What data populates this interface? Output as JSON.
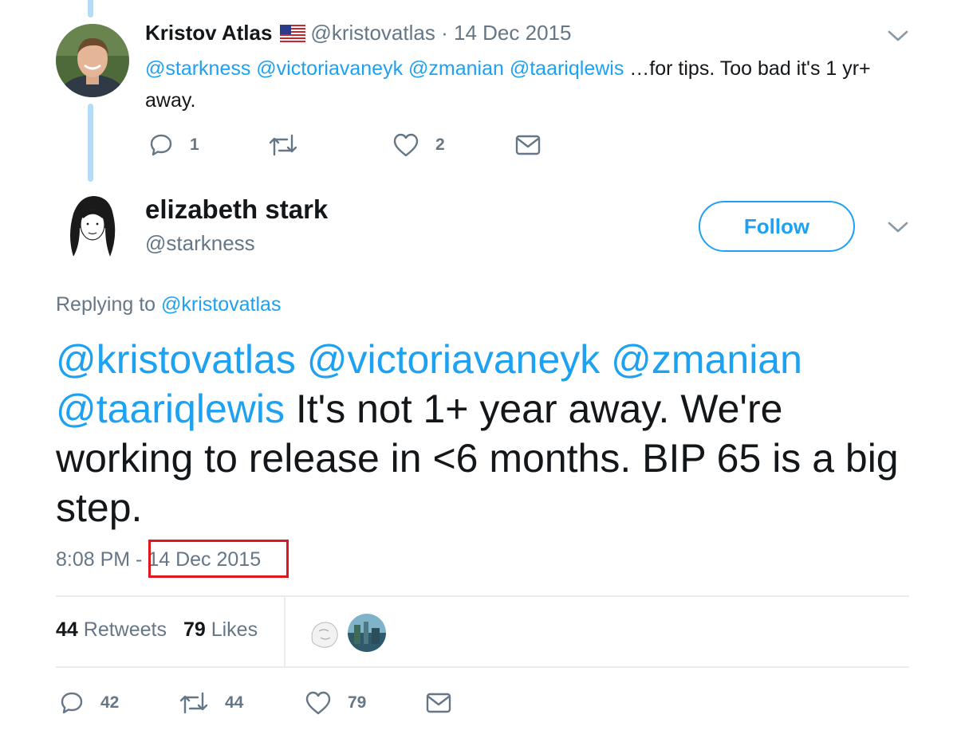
{
  "thread_parent": {
    "author_name": "Kristov Atlas",
    "author_flag": "us-flag-icon",
    "author_handle": "@kristovatlas",
    "separator": "·",
    "date": "14 Dec 2015",
    "text_mentions": "@starkness @victoriavaneyk @zmanian @taariqlewis",
    "text_body": " …for tips. Too bad it's 1 yr+ away.",
    "actions": {
      "reply_count": "1",
      "retweet_count": "",
      "like_count": "2"
    }
  },
  "tweet": {
    "author_name": "elizabeth stark",
    "author_handle": "@starkness",
    "follow_label": "Follow",
    "replying_prefix": "Replying to ",
    "replying_handle": "@kristovatlas",
    "text_mentions": "@kristovatlas @victoriavaneyk @zmanian @taariqlewis",
    "text_body": " It's not 1+ year away. We're working to release in <6 months. BIP 65 is a big step.",
    "time": "8:08 PM",
    "time_separator": " - ",
    "date": "14 Dec 2015",
    "stats": {
      "retweets_count": "44",
      "retweets_label": "Retweets",
      "likes_count": "79",
      "likes_label": "Likes"
    },
    "actions": {
      "reply_count": "42",
      "retweet_count": "44",
      "like_count": "79"
    }
  },
  "colors": {
    "link": "#1da1f2",
    "muted": "#657786",
    "thread_line": "#b4dcf8",
    "highlight": "#e0161c"
  }
}
